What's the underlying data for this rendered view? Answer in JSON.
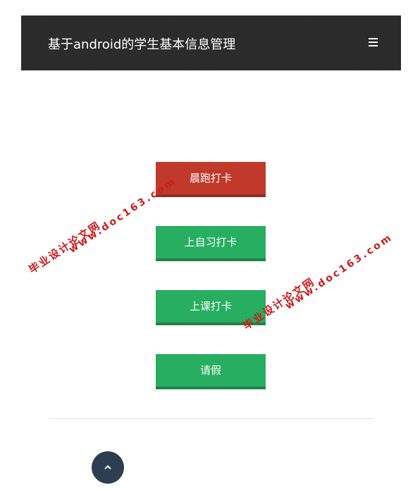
{
  "header": {
    "title": "基于android的学生基本信息管理",
    "menu_icon": "menu-icon"
  },
  "actions": [
    {
      "label": "晨跑打卡",
      "color": "#c0392b"
    },
    {
      "label": "上自习打卡",
      "color": "#27ae60"
    },
    {
      "label": "上课打卡",
      "color": "#27ae60"
    },
    {
      "label": "请假",
      "color": "#27ae60"
    }
  ],
  "back_to_top": {
    "icon": "chevron-up-icon",
    "color": "#2c3e50"
  },
  "watermark": {
    "site_name": "毕业设计论文网",
    "url": "www.doc163.com"
  }
}
